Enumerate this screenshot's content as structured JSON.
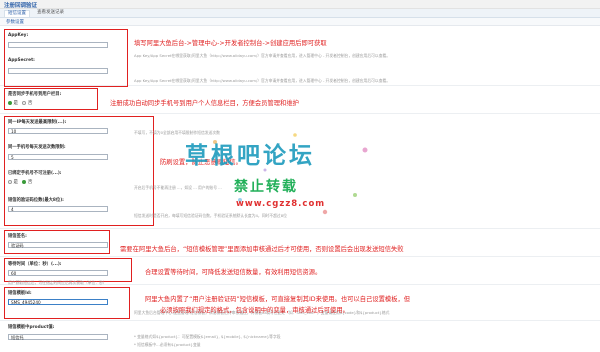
{
  "app": {
    "title": "注册回调验证"
  },
  "tabs": [
    {
      "label": "短信设置"
    },
    {
      "label": "查看发送记录"
    }
  ],
  "section": {
    "title": "参数设置"
  },
  "fields": {
    "appkey": {
      "label": "AppKey:",
      "value": ""
    },
    "appsecret": {
      "label": "AppSecret:",
      "value": "",
      "desc": "App Key/App Secret在哪里获取(阿里大鱼（http://www.alidayu.com/）官方申请并查看应用，进入管理中心 - 开发者控制台，创建应用后可以查看。"
    },
    "sync_mobile": {
      "label": "是否同步手机号到用户栏目:",
      "opt_yes": "是",
      "opt_no": "否"
    },
    "ip_limit": {
      "label": "同一IP每天发送最高限制(...):",
      "value": "10",
      "desc": "不填写，不填为0全部启用不填限制作短信发送次数"
    },
    "mobile_limit": {
      "label": "同一手机号每天发送次数限制:",
      "value": "5"
    },
    "reg_check": {
      "label": "已绑定手机号不可注册(...):",
      "opt_yes": "是",
      "opt_no": "否",
      "desc": "开启后手机号不能再注册 ...，如设 ... 用户的账号 ..."
    },
    "code_len": {
      "label": "短信的验证码位数(最大8位):",
      "value": "4",
      "desc": "短信发送时是否开启，每填写短信验证码位数，手机验证系统默认长度为4，同时不超过8位"
    },
    "sign": {
      "label": "短信签名:",
      "value": "验证码"
    },
    "interval": {
      "label": "等待时间（单位：秒）(...):",
      "value": "60",
      "desc": "用户获取短信后，可在指定时间过后再次获取（单位：秒）"
    },
    "template": {
      "label": "短信模板Id:",
      "value": "SMS_4945240",
      "desc": "阿里大鱼后台管理中心-配置管理-短信模板，添加模板后待审核通过，将模板ID填写在此处（如：SMS_xxx），变量请使用${code}和${product}格式"
    },
    "product": {
      "label": "短信模板中product值:",
      "value": "短信托",
      "desc1": "* 变量格式如${product}：可配置模板${email}, ${mobile}, ${nickname}等字段",
      "desc2": "* 短信模板中...必须有${product}变量"
    }
  },
  "notes": {
    "n1": "填写阿里大鱼后台->管理中心->开发者控制台->创建应用后即可获取",
    "n2": "注册成功自动同步手机号到用户个人信息栏目，方便会员管理和维护",
    "n3": "防刷设置，防止恶意刷短信。",
    "n4": "需要在阿里大鱼后台，“短信模板管理”里面添加审核通过后才可使用，否则设置后会出现发送短信失败",
    "n5": "合理设置等待时间，可降低发送短信数量，有效利用短信资源。",
    "n6a": "阿里大鱼内置了“用户注册验证码”短信模板，可直接复制其ID来使用。也可以自己设置模板，但",
    "n6b": "必须按照我们规定的格式，包含说明中的变量，审核通过后可使用。"
  },
  "watermark": {
    "line1": "草根吧论坛",
    "line2": "禁止转载",
    "line3": "www.cgzz8.com"
  }
}
